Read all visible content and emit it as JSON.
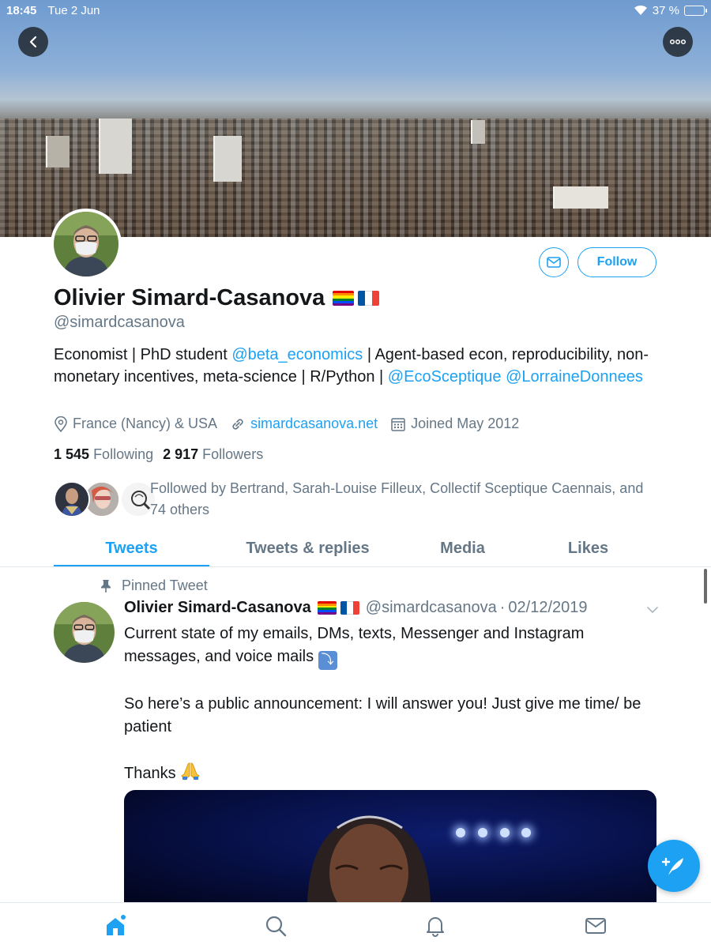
{
  "status_bar": {
    "time": "18:45",
    "date": "Tue 2 Jun",
    "battery": "37 %",
    "battery_level": 0.37
  },
  "header": {
    "back_icon": "chevron-left-icon",
    "more_icon": "more-horizontal-icon"
  },
  "profile": {
    "name": "Olivier Simard-Casanova",
    "flags": [
      "rainbow-flag",
      "france-flag"
    ],
    "handle": "@simardcasanova",
    "bio": {
      "part1": "Economist | PhD student ",
      "mention1": "@beta_economics",
      "part2": " | Agent-based econ, reproducibility, non-monetary incentives, meta-science | R/Python | ",
      "mention2": "@EcoSceptique",
      "mention3": "@LorraineDonnees"
    },
    "location": "France (Nancy) & USA",
    "website": "simardcasanova.net",
    "joined": "Joined May 2012",
    "following_count": "1 545",
    "following_label": "Following",
    "followers_count": "2 917",
    "followers_label": "Followers",
    "followed_by": "Followed by Bertrand, Sarah-Louise Filleux, Collectif Sceptique Caennais, and 74 others",
    "follow_label": "Follow"
  },
  "tabs": [
    {
      "label": "Tweets",
      "active": true
    },
    {
      "label": "Tweets & replies",
      "active": false
    },
    {
      "label": "Media",
      "active": false
    },
    {
      "label": "Likes",
      "active": false
    }
  ],
  "pinned_tweet": {
    "pinned_label": "Pinned Tweet",
    "author": "Olivier Simard-Casanova",
    "handle": "@simardcasanova",
    "separator": "·",
    "date": "02/12/2019",
    "line1": "Current state of my emails, DMs, texts, Messenger and Instagram messages, and voice mails ",
    "line2": "So here’s a public announcement: I will answer you! Just give me time/ be patient",
    "line3": "Thanks "
  },
  "colors": {
    "accent": "#1da1f2",
    "text": "#14171a",
    "secondary": "#657786"
  },
  "bottom_nav": [
    "home-icon",
    "search-icon",
    "notifications-icon",
    "messages-icon"
  ]
}
